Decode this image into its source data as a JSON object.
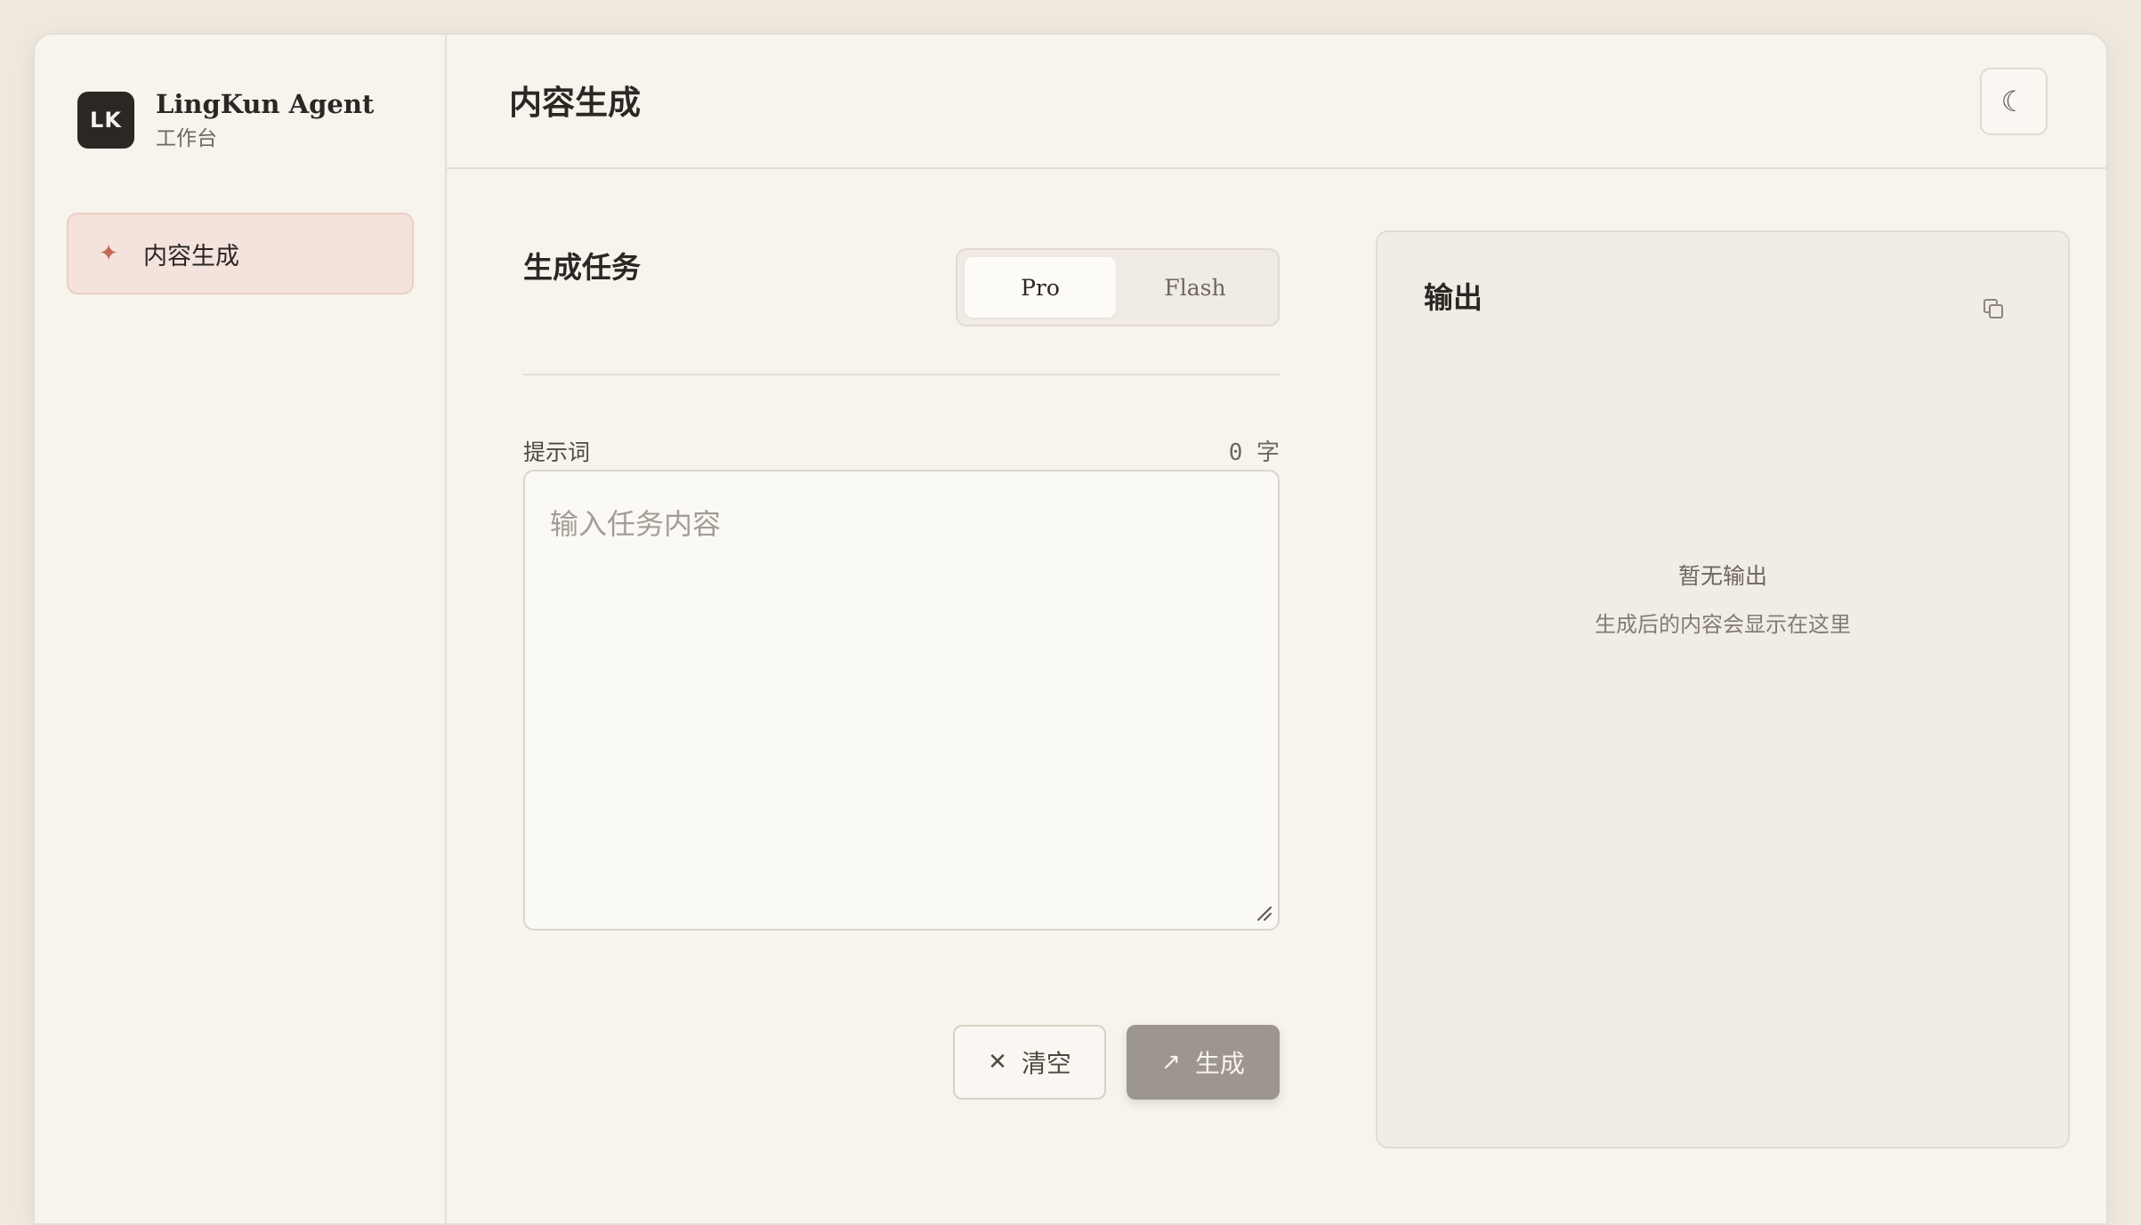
{
  "brand": {
    "logo_text": "LK",
    "name": "LingKun Agent",
    "subtitle": "工作台"
  },
  "sidebar": {
    "items": [
      {
        "label": "内容生成",
        "icon": "sparkle-icon",
        "active": true
      }
    ]
  },
  "header": {
    "title": "内容生成",
    "theme_toggle_icon": "moon-icon"
  },
  "task": {
    "title": "生成任务",
    "modes": [
      {
        "label": "Pro",
        "active": true
      },
      {
        "label": "Flash",
        "active": false
      }
    ]
  },
  "prompt": {
    "label": "提示词",
    "char_count": "0 字",
    "value": "",
    "placeholder": "输入任务内容"
  },
  "actions": {
    "clear_label": "清空",
    "clear_icon": "x-icon",
    "generate_label": "生成",
    "generate_icon": "arrow-up-right-icon"
  },
  "output": {
    "title": "输出",
    "copy_icon": "copy-icon",
    "empty_title": "暂无输出",
    "empty_subtitle": "生成后的内容会显示在这里"
  },
  "colors": {
    "background": "#f7f3ed",
    "accent": "#c26a55",
    "active_nav_bg": "#f3e3dc",
    "generate_button_bg": "#9c968e",
    "text_primary": "#2b2723"
  }
}
